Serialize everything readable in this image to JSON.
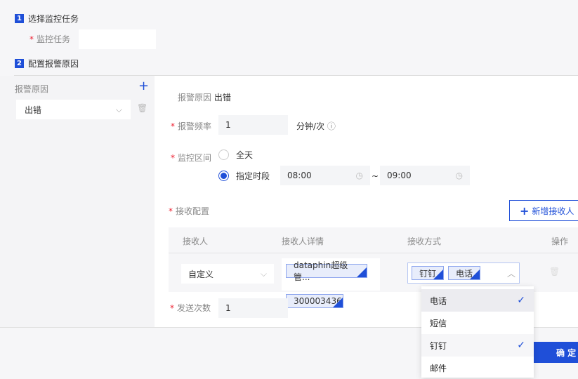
{
  "steps": [
    {
      "num": "1",
      "label": "选择监控任务"
    },
    {
      "num": "2",
      "label": "配置报警原因"
    }
  ],
  "monitor_task_label": "监控任务",
  "reason_list": {
    "title": "报警原因",
    "items": [
      {
        "label": "出错"
      }
    ]
  },
  "form": {
    "reason_label": "报警原因",
    "reason_value": "出错",
    "freq_label": "报警频率",
    "freq_value": "1",
    "freq_unit": "分钟/次",
    "range_label": "监控区间",
    "opt_all": "全天",
    "opt_period": "指定时段",
    "start": "08:00",
    "tilde": "~",
    "end": "09:00",
    "recv_label": "接收配置",
    "add_recv": "新增接收人",
    "table": {
      "headers": [
        "接收人",
        "接收人详情",
        "接收方式",
        "操作"
      ],
      "row": {
        "receiver": "自定义",
        "details": [
          "dataphin超级管...",
          "300003436"
        ],
        "methods": [
          "钉钉",
          "电话"
        ]
      }
    },
    "send_label": "发送次数",
    "send_value": "1"
  },
  "dropdown": [
    {
      "label": "电话",
      "checked": true
    },
    {
      "label": "短信",
      "checked": false
    },
    {
      "label": "钉钉",
      "checked": true
    },
    {
      "label": "邮件",
      "checked": false
    }
  ],
  "confirm": "确 定"
}
